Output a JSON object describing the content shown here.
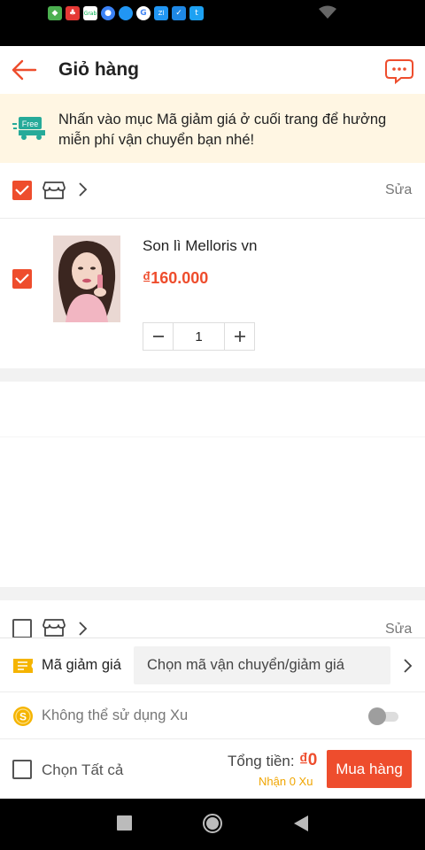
{
  "header": {
    "title": "Giỏ hàng"
  },
  "banner": {
    "text": "Nhấn vào mục Mã giảm giá ở cuối trang để hưởng miễn phí vận chuyển bạn nhé!",
    "badge": "Free"
  },
  "shops": [
    {
      "edit_label": "Sửa",
      "checked": true,
      "items": [
        {
          "name": "Son lì Melloris vn",
          "price": "₫160.000",
          "quantity": "1",
          "checked": true
        }
      ]
    },
    {
      "edit_label": "Sửa",
      "checked": false,
      "items": []
    }
  ],
  "footer": {
    "voucher_label": "Mã giảm giá",
    "voucher_placeholder": "Chọn mã vận chuyển/giảm giá",
    "coin_label": "Không thể sử dụng Xu",
    "select_all_label": "Chọn Tất cả",
    "total_label": "Tổng tiền:",
    "total_value": "₫0",
    "coin_earn": "Nhận 0 Xu",
    "buy_label": "Mua hàng"
  },
  "colors": {
    "accent": "#ee4d2d",
    "banner_bg": "#fff6e3",
    "free_badge": "#26aa99",
    "coin": "#f0a500"
  },
  "icons": {
    "status_apps": [
      "shield-app-icon",
      "app-icon",
      "grab-icon",
      "messenger-icon",
      "circle-app-icon",
      "google-icon",
      "zalo-icon",
      "shield-check-icon",
      "twitter-icon"
    ],
    "header": [
      "back-arrow-icon",
      "chat-bubble-icon"
    ],
    "shop": [
      "store-icon",
      "chevron-right-icon"
    ],
    "footer": [
      "voucher-ticket-icon",
      "coin-icon"
    ]
  }
}
